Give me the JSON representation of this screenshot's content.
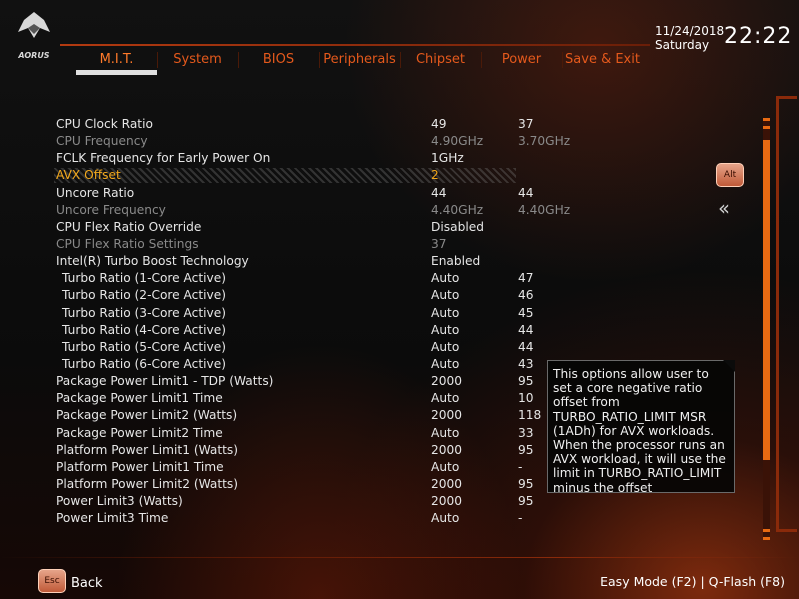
{
  "brand": {
    "name": "AORUS"
  },
  "tabs": [
    "M.I.T.",
    "System",
    "BIOS",
    "Peripherals",
    "Chipset",
    "Power",
    "Save & Exit"
  ],
  "clock": {
    "date": "11/24/2018",
    "weekday": "Saturday",
    "time": "22:22"
  },
  "settings": [
    {
      "label": "CPU Clock Ratio",
      "v1": "49",
      "v2": "37",
      "state": "normal",
      "indent": false
    },
    {
      "label": "CPU Frequency",
      "v1": "4.90GHz",
      "v2": "3.70GHz",
      "state": "dim",
      "indent": false
    },
    {
      "label": "FCLK Frequency for Early Power On",
      "v1": "1GHz",
      "v2": "",
      "state": "normal",
      "indent": false
    },
    {
      "label": "AVX Offset",
      "v1": "2",
      "v2": "",
      "state": "selected",
      "indent": false
    },
    {
      "label": "Uncore Ratio",
      "v1": "44",
      "v2": "44",
      "state": "normal",
      "indent": false
    },
    {
      "label": "Uncore Frequency",
      "v1": "4.40GHz",
      "v2": "4.40GHz",
      "state": "dim",
      "indent": false
    },
    {
      "label": "CPU Flex Ratio Override",
      "v1": "Disabled",
      "v2": "",
      "state": "normal",
      "indent": false
    },
    {
      "label": "CPU Flex Ratio Settings",
      "v1": "37",
      "v2": "",
      "state": "dim",
      "indent": false
    },
    {
      "label": "Intel(R) Turbo Boost Technology",
      "v1": "Enabled",
      "v2": "",
      "state": "normal",
      "indent": false
    },
    {
      "label": "Turbo Ratio (1-Core Active)",
      "v1": "Auto",
      "v2": "47",
      "state": "normal",
      "indent": true
    },
    {
      "label": "Turbo Ratio (2-Core Active)",
      "v1": "Auto",
      "v2": "46",
      "state": "normal",
      "indent": true
    },
    {
      "label": "Turbo Ratio (3-Core Active)",
      "v1": "Auto",
      "v2": "45",
      "state": "normal",
      "indent": true
    },
    {
      "label": "Turbo Ratio (4-Core Active)",
      "v1": "Auto",
      "v2": "44",
      "state": "normal",
      "indent": true
    },
    {
      "label": "Turbo Ratio (5-Core Active)",
      "v1": "Auto",
      "v2": "44",
      "state": "normal",
      "indent": true
    },
    {
      "label": "Turbo Ratio (6-Core Active)",
      "v1": "Auto",
      "v2": "43",
      "state": "normal",
      "indent": true
    },
    {
      "label": "Package Power Limit1 - TDP (Watts)",
      "v1": "2000",
      "v2": "95",
      "state": "normal",
      "indent": false
    },
    {
      "label": "Package Power Limit1 Time",
      "v1": "Auto",
      "v2": "10",
      "state": "normal",
      "indent": false
    },
    {
      "label": "Package Power Limit2 (Watts)",
      "v1": "2000",
      "v2": "118",
      "state": "normal",
      "indent": false
    },
    {
      "label": "Package Power Limit2 Time",
      "v1": "Auto",
      "v2": "33",
      "state": "normal",
      "indent": false
    },
    {
      "label": "Platform Power Limit1 (Watts)",
      "v1": "2000",
      "v2": "95",
      "state": "normal",
      "indent": false
    },
    {
      "label": "Platform Power Limit1 Time",
      "v1": "Auto",
      "v2": "-",
      "state": "normal",
      "indent": false
    },
    {
      "label": "Platform Power Limit2 (Watts)",
      "v1": "2000",
      "v2": "95",
      "state": "normal",
      "indent": false
    },
    {
      "label": "Power Limit3 (Watts)",
      "v1": "2000",
      "v2": "95",
      "state": "normal",
      "indent": false
    },
    {
      "label": "Power Limit3 Time",
      "v1": "Auto",
      "v2": "-",
      "state": "normal",
      "indent": false
    }
  ],
  "help": {
    "text": "This options allow user to set a core negative ratio offset from TURBO_RATIO_LIMIT MSR (1ADh) for AVX workloads. When the processor runs an AVX workload, it will use the limit in TURBO_RATIO_LIMIT minus the offset"
  },
  "side": {
    "alt_label": "Alt"
  },
  "footer": {
    "esc_label": "Esc",
    "back": "Back",
    "easy_mode": "Easy Mode (F2)",
    "separator": " | ",
    "qflash": "Q-Flash (F8)"
  },
  "colors": {
    "accent": "#e4591c",
    "selected_text": "#f2a81c",
    "dim_text": "#8a8a8a"
  }
}
